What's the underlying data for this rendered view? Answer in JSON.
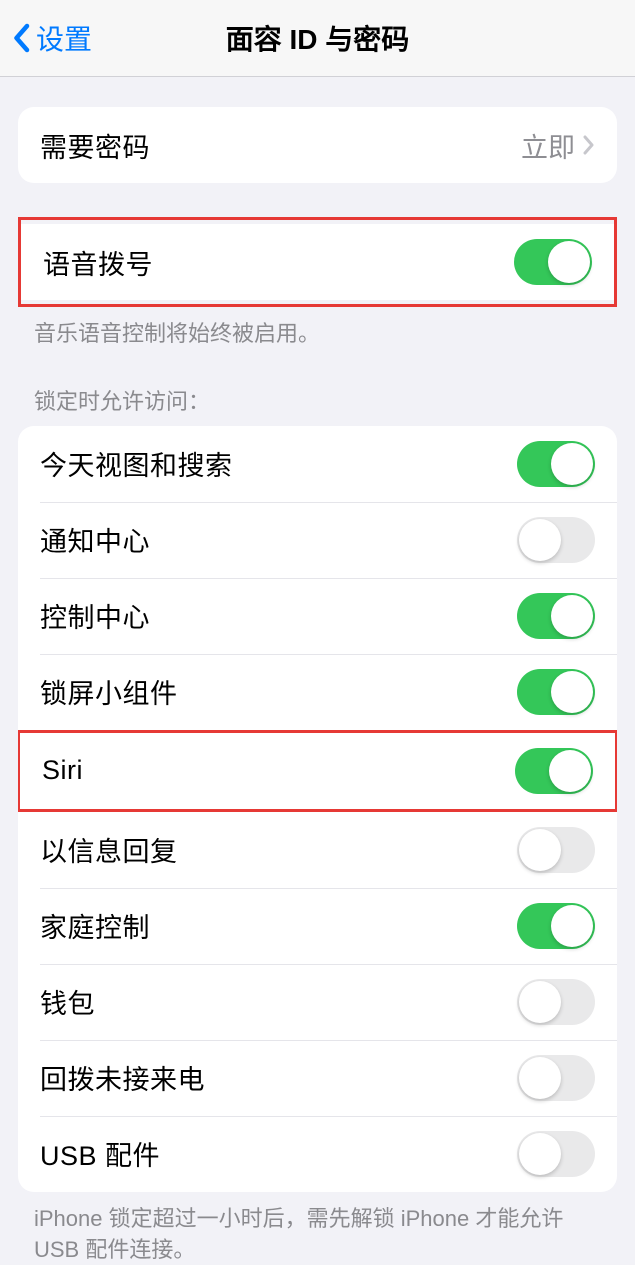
{
  "nav": {
    "back_label": "设置",
    "title": "面容 ID 与密码"
  },
  "require_passcode": {
    "label": "需要密码",
    "value": "立即"
  },
  "voice_dial": {
    "label": "语音拨号",
    "enabled": true,
    "footer": "音乐语音控制将始终被启用。"
  },
  "lock_access": {
    "header": "锁定时允许访问：",
    "items": [
      {
        "label": "今天视图和搜索",
        "enabled": true
      },
      {
        "label": "通知中心",
        "enabled": false
      },
      {
        "label": "控制中心",
        "enabled": true
      },
      {
        "label": "锁屏小组件",
        "enabled": true
      },
      {
        "label": "Siri",
        "enabled": true
      },
      {
        "label": "以信息回复",
        "enabled": false
      },
      {
        "label": "家庭控制",
        "enabled": true
      },
      {
        "label": "钱包",
        "enabled": false
      },
      {
        "label": "回拨未接来电",
        "enabled": false
      },
      {
        "label": "USB 配件",
        "enabled": false
      }
    ],
    "footer": "iPhone 锁定超过一小时后，需先解锁 iPhone 才能允许 USB 配件连接。"
  },
  "highlights": {
    "voice_dial": true,
    "siri_index": 4
  }
}
